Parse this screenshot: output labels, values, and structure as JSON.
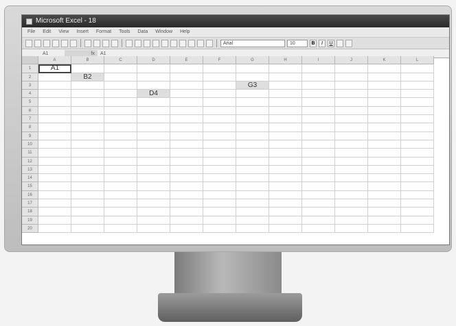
{
  "window": {
    "title": "Microsoft Excel - 18"
  },
  "menu": [
    "File",
    "Edit",
    "View",
    "Insert",
    "Format",
    "Tools",
    "Data",
    "Window",
    "Help"
  ],
  "toolbar": {
    "font_name": "Arial",
    "font_size": "10",
    "bold": "B",
    "italic": "I",
    "underline": "U"
  },
  "formula_bar": {
    "name_box": "A1",
    "fx_label": "fx",
    "formula": "A1"
  },
  "columns": [
    "A",
    "B",
    "C",
    "D",
    "E",
    "F",
    "G",
    "H",
    "I",
    "J",
    "K",
    "L"
  ],
  "rows": [
    "1",
    "2",
    "3",
    "4",
    "5",
    "6",
    "7",
    "8",
    "9",
    "10",
    "11",
    "12",
    "13",
    "14",
    "15",
    "16",
    "17",
    "18",
    "19",
    "20"
  ],
  "cells": [
    {
      "row": 1,
      "col": 1,
      "value": "A1",
      "active": true
    },
    {
      "row": 2,
      "col": 2,
      "value": "B2"
    },
    {
      "row": 4,
      "col": 4,
      "value": "D4"
    },
    {
      "row": 3,
      "col": 7,
      "value": "G3"
    }
  ],
  "colors": {
    "titlebar": "#2e2e2e",
    "header_bg": "#e3e3e3",
    "filled_cell": "#dedede"
  }
}
